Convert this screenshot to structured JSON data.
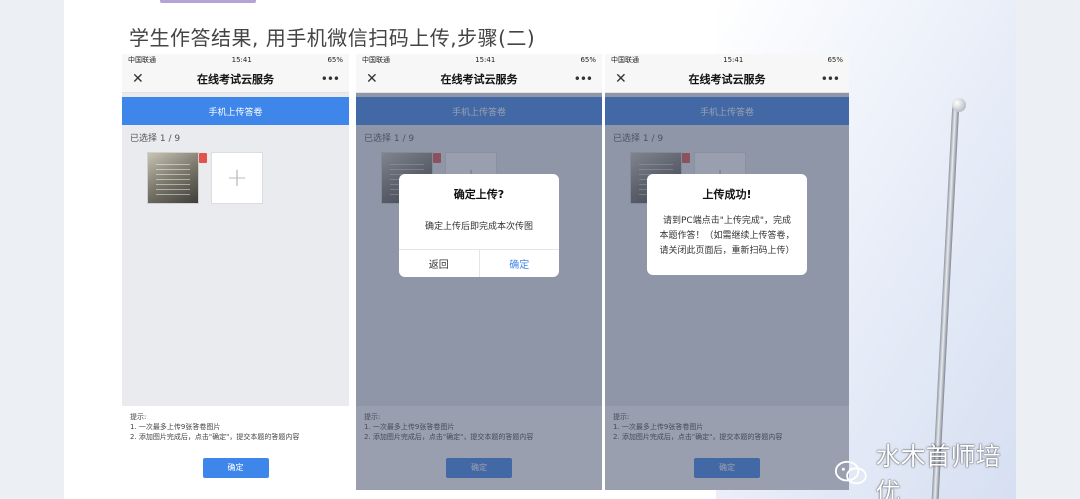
{
  "slide": {
    "title": "学生作答结果, 用手机微信扫码上传,步骤(二)"
  },
  "status": {
    "carrier": "中国联通",
    "time": "15:41",
    "battery": "65%"
  },
  "app": {
    "title": "在线考试云服务",
    "close_glyph": "✕",
    "more_glyph": "•••",
    "upload_label": "手机上传答卷",
    "selected_count": "已选择 1 / 9",
    "add_glyph": "+",
    "tips_heading": "提示:",
    "tip_1": "1. 一次最多上传9张答卷图片",
    "tip_2": "2. 添加图片完成后，点击\"确定\"，提交本题的答题内容",
    "confirm_label": "确定"
  },
  "dialog_confirm": {
    "title": "确定上传?",
    "body": "确定上传后即完成本次传图",
    "back_label": "返回",
    "ok_label": "确定"
  },
  "dialog_success": {
    "title": "上传成功!",
    "body": "请到PC端点击\"上传完成\"，完成本题作答！（如需继续上传答卷，请关闭此页面后，重新扫码上传）"
  },
  "watermark": {
    "text": "水木首师培优"
  },
  "colors": {
    "primary": "#3f86ea",
    "mask": "#4a5370"
  }
}
